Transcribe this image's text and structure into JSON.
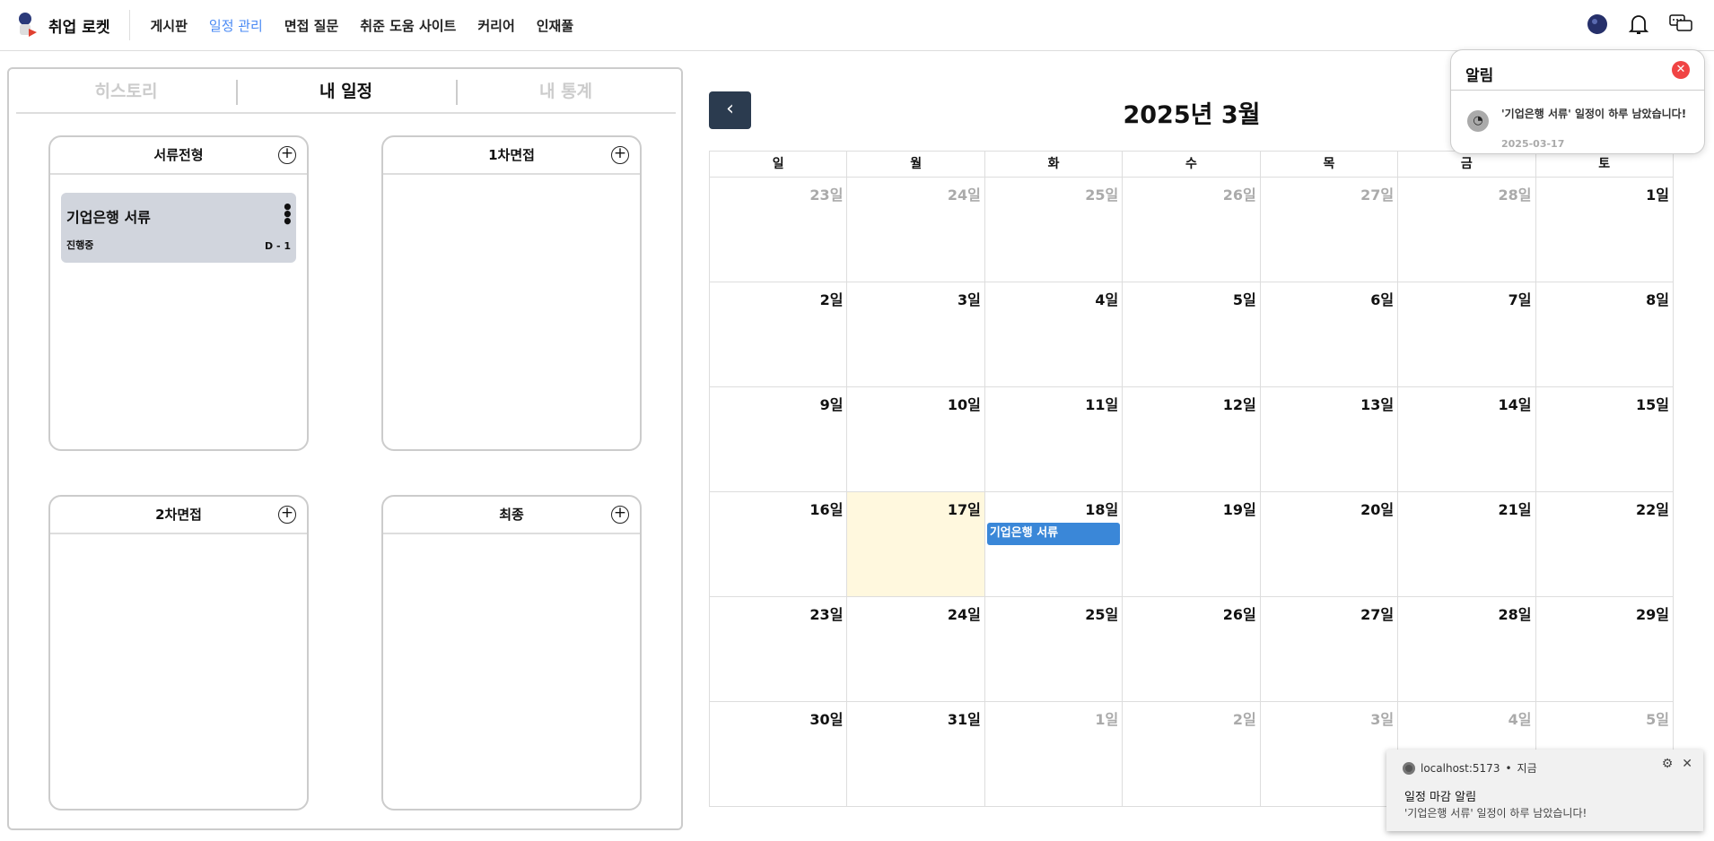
{
  "header": {
    "logo_text": "취업 로켓",
    "nav": [
      "게시판",
      "일정 관리",
      "면접 질문",
      "취준 도움 사이트",
      "커리어",
      "인재풀"
    ],
    "active_nav": "일정 관리"
  },
  "tabs": [
    "히스토리",
    "내 일정",
    "내 통계"
  ],
  "active_tab": "내 일정",
  "columns": [
    {
      "title": "서류전형",
      "items": [
        {
          "title": "기업은행 서류",
          "status": "진행중",
          "dday": "D - 1"
        }
      ]
    },
    {
      "title": "1차면접",
      "items": []
    },
    {
      "title": "2차면접",
      "items": []
    },
    {
      "title": "최종",
      "items": []
    }
  ],
  "calendar": {
    "title": "2025년 3월",
    "weekdays": [
      "일",
      "월",
      "화",
      "수",
      "목",
      "금",
      "토"
    ],
    "weeks": [
      [
        "23일",
        "24일",
        "25일",
        "26일",
        "27일",
        "28일",
        "1일"
      ],
      [
        "2일",
        "3일",
        "4일",
        "5일",
        "6일",
        "7일",
        "8일"
      ],
      [
        "9일",
        "10일",
        "11일",
        "12일",
        "13일",
        "14일",
        "15일"
      ],
      [
        "16일",
        "17일",
        "18일",
        "19일",
        "20일",
        "21일",
        "22일"
      ],
      [
        "23일",
        "24일",
        "25일",
        "26일",
        "27일",
        "28일",
        "29일"
      ],
      [
        "30일",
        "31일",
        "1일",
        "2일",
        "3일",
        "4일",
        "5일"
      ]
    ],
    "today": "17일",
    "event": {
      "date": "18일",
      "title": "기업은행 서류",
      "color": "#3a87d8"
    }
  },
  "notification_popup": {
    "title": "알림",
    "message": "'기업은행 서류' 일정이 하루 남았습니다!",
    "date": "2025-03-17"
  },
  "browser_toast": {
    "source": "localhost:5173",
    "time": "지금",
    "title": "일정 마감 알림",
    "body": "'기업은행 서류' 일정이 하루 남았습니다!"
  },
  "colors": {
    "accent": "#4a8af4",
    "today_bg": "#fff8de",
    "back_button": "#2b3b4f",
    "close": "#f04444"
  }
}
